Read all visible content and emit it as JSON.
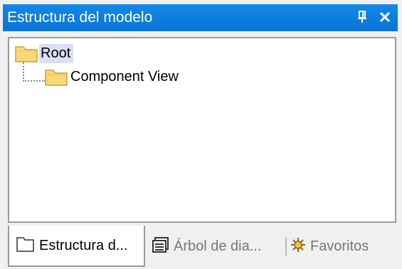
{
  "window": {
    "title": "Estructura del modelo",
    "pin_icon": "pin-icon",
    "close_icon": "close-icon"
  },
  "tree": {
    "root": {
      "label": "Root",
      "icon": "folder-icon"
    },
    "children": [
      {
        "label": "Component View",
        "icon": "folder-icon"
      }
    ]
  },
  "tabs": [
    {
      "label": "Estructura d...",
      "icon": "model-tree-icon",
      "active": true
    },
    {
      "label": "Árbol de dia...",
      "icon": "diagram-tree-icon",
      "active": false
    },
    {
      "label": "Favoritos",
      "icon": "favorites-icon",
      "active": false
    }
  ],
  "colors": {
    "titlebar": "#0a73d6",
    "selection": "#dcdff5",
    "folder": "#f7d978"
  }
}
